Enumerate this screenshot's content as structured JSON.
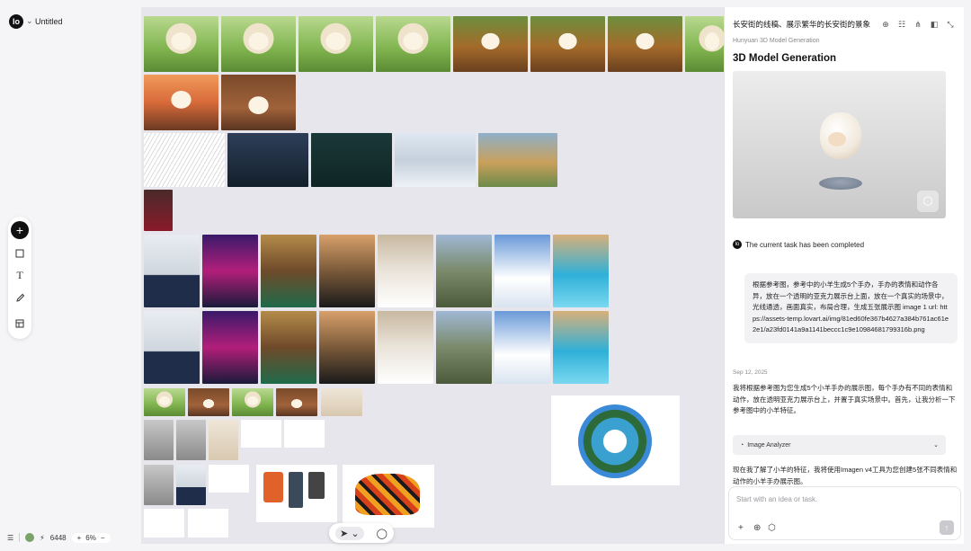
{
  "app": {
    "logo_glyph": "lo",
    "project_title": "Untitled"
  },
  "toolbar": {
    "add_icon": "plus-icon",
    "rect_icon": "square-icon",
    "text_icon": "text-icon",
    "pen_icon": "pencil-icon",
    "frame_icon": "frame-icon"
  },
  "bottom_bar": {
    "credits": "6448",
    "zoom_out": "+",
    "zoom_level": "6%",
    "zoom_in": "−"
  },
  "canvas_tools": {
    "select_icon": "cursor-arrow-icon",
    "comment_icon": "comment-icon"
  },
  "panel": {
    "title": "长安街的线稿、展示繁华的长安街的景象",
    "model_source": "Hunyuan 3D Model Generation",
    "model_heading": "3D Model Generation",
    "completed_text": "The current task has been completed",
    "user_message": "根据参考图，参考中的小羊生成5个手办，手办的表情和动作各异，放在一个透明的亚克力展示台上面，放在一个真实的场景中，光线通透，画面真实，布局合理，生成五张展示图 image 1 url: https://assets-temp.lovart.ai/img/81ed60fe367b4627a384b761ac61e2e1/a23fd0141a9a1141beccc1c9e10984681799316b.png",
    "message_date": "Sep 12, 2025",
    "ai_text_1": "我将根据参考图为您生成5个小羊手办的展示图，每个手办有不同的表情和动作，放在透明亚克力展示台上，并置于真实场景中。首先，让我分析一下参考图中的小羊特征。",
    "tool_card_label": "Image Analyzer",
    "ai_text_2": "现在我了解了小羊的特征，我将使用Imagen v4工具为您创建5张不同表情和动作的小羊手办展示图。",
    "composer_placeholder": "Start with an idea or task."
  }
}
